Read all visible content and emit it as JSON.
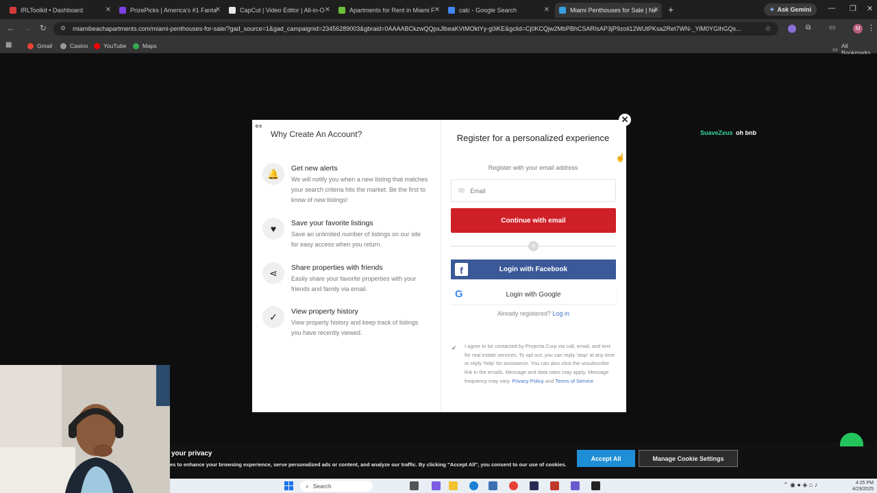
{
  "browser": {
    "tabs": [
      {
        "label": "IRLToolkit • Dashboard",
        "color": "#d23b3b"
      },
      {
        "label": "PrizePicks | America's #1 Fanta",
        "color": "#7b3fe4"
      },
      {
        "label": "CapCut | Video Editor | All-in-O",
        "color": "#e8e8e8"
      },
      {
        "label": "Apartments for Rent in Miami F",
        "color": "#6bbf3a"
      },
      {
        "label": "calc - Google Search",
        "color": "#4285f4"
      },
      {
        "label": "Miami Penthouses for Sale | Ne",
        "color": "#3aa0e0"
      }
    ],
    "new_tab": "+",
    "ask_gemini": "Ask Gemini",
    "url": "miamibeachapartments.com/miami-penthouses-for-sale/?gad_source=1&gad_campaignid=23456289003&gbraid=0AAAABCkzwQQpxJlbeaKVtMOktYy-g0iKE&gclid=Cj0KCQjw2MbPBhCSARIsAP3jP9zoli12WUtPKsa2Ret7WN-_YlM0YGIhGQs...",
    "bookmarks": [
      {
        "label": "Gmail",
        "color": "#ea4335"
      },
      {
        "label": "Casino",
        "color": "#999999"
      },
      {
        "label": "YouTube",
        "color": "#ff0000"
      },
      {
        "label": "Maps",
        "color": "#34a853"
      }
    ],
    "all_bookmarks": "All Bookmarks"
  },
  "modal": {
    "why_title": "Why Create An Account?",
    "features": [
      {
        "icon": "bell-icon",
        "glyph": "🔔",
        "title": "Get new alerts",
        "desc": "We will notify you when a new listing that matches your search criteria hits the market. Be the first to know of new listings!"
      },
      {
        "icon": "heart-icon",
        "glyph": "♥",
        "title": "Save your favorite listings",
        "desc": "Save an unlimited number of listings on our site for easy access when you return."
      },
      {
        "icon": "share-icon",
        "glyph": "⋖",
        "title": "Share properties with friends",
        "desc": "Easily share your favorite properties with your friends and family via email."
      },
      {
        "icon": "checkmark-icon",
        "glyph": "✓",
        "title": "View property history",
        "desc": "View property history and keep track of listings you have recently viewed."
      }
    ],
    "register_title": "Register for a personalized experience",
    "register_sub": "Register with your email address",
    "email_placeholder": "Email",
    "continue_label": "Continue with email",
    "or_label": "or",
    "facebook_label": "Login with Facebook",
    "google_label": "Login with Google",
    "already_label": "Already registered?",
    "login_link": "Log in",
    "consent_text": "I agree to be contacted by Projecta Corp via call, email, and text for real estate services. To opt out, you can reply 'stop' at any time or reply 'help' for assistance. You can also click the unsubscribe link in the emails. Message and data rates may apply. Message frequency may vary.",
    "privacy_link": "Privacy Policy",
    "and_text": "and",
    "terms_link": "Terms of Service",
    "close_glyph": "✕"
  },
  "chat": {
    "user": "SuaveZeus",
    "message": "oh bnb"
  },
  "cookie": {
    "title": "your privacy",
    "text": "es to enhance your browsing experience, serve personalized ads or content, and analyze our traffic. By clicking \"Accept All\", you consent to our use of cookies.",
    "accept_label": "Accept All",
    "manage_label": "Manage Cookie Settings"
  },
  "taskbar": {
    "search_label": "Search",
    "time": "4:25 PM",
    "date": "4/29/2025"
  }
}
